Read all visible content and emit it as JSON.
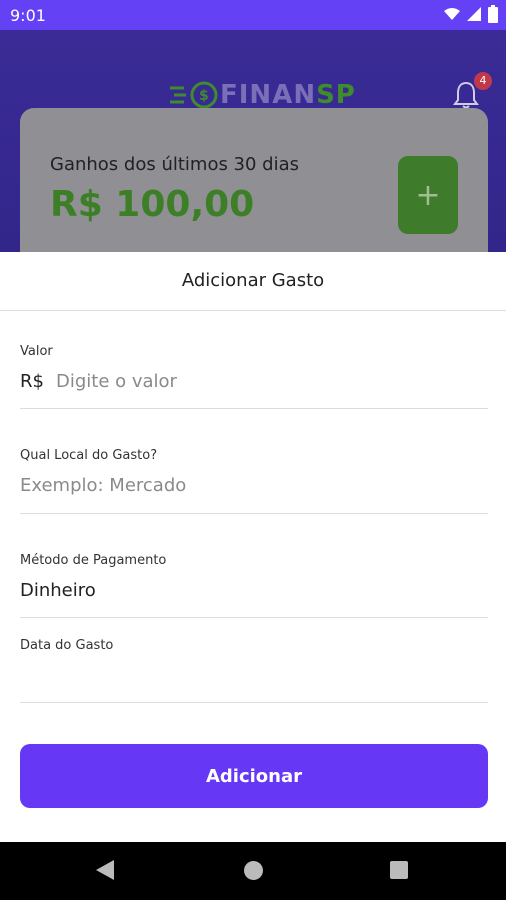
{
  "status_bar": {
    "time": "9:01"
  },
  "header": {
    "logo": {
      "part1": "FINAN",
      "part2": "SP"
    },
    "notifications_count": "4"
  },
  "earnings_card": {
    "label": "Ganhos dos últimos 30 dias",
    "value": "R$ 100,00",
    "add_button": "+"
  },
  "sheet": {
    "title": "Adicionar Gasto",
    "fields": [
      {
        "label": "Valor",
        "prefix": "R$",
        "placeholder": "Digite o valor"
      },
      {
        "label": "Qual Local do Gasto?",
        "placeholder": "Exemplo: Mercado"
      },
      {
        "label": "Método de Pagamento",
        "value": "Dinheiro"
      },
      {
        "label": "Data do Gasto",
        "value": ""
      }
    ],
    "submit_label": "Adicionar"
  },
  "colors": {
    "primary": "#6638f6",
    "header_bg": "#3a2b96",
    "earn_value": "#3d7f26",
    "badge": "#c0394a"
  }
}
